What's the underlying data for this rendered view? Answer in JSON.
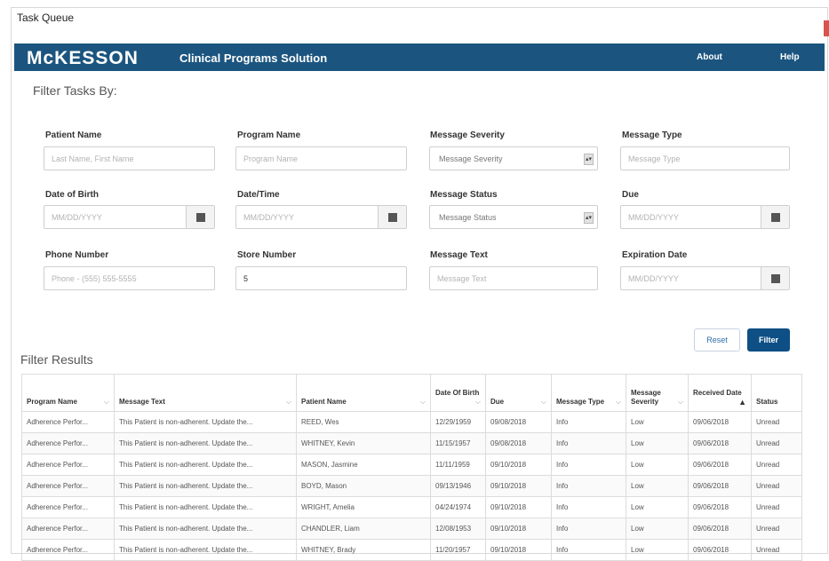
{
  "window": {
    "title": "Task Queue"
  },
  "header": {
    "brand": "McKESSON",
    "subtitle": "Clinical Programs Solution",
    "nav_about": "About",
    "nav_help": "Help",
    "bg_color": "#1b557f"
  },
  "filter": {
    "heading": "Filter Tasks By:",
    "patient_name": {
      "label": "Patient Name",
      "placeholder": "Last Name, First Name"
    },
    "program_name": {
      "label": "Program Name",
      "placeholder": "Program Name"
    },
    "message_severity": {
      "label": "Message Severity",
      "value": "Message Severity"
    },
    "message_type": {
      "label": "Message Type",
      "placeholder": "Message Type"
    },
    "date_of_birth": {
      "label": "Date of Birth",
      "placeholder": "MM/DD/YYYY"
    },
    "date_time": {
      "label": "Date/Time",
      "placeholder": "MM/DD/YYYY"
    },
    "message_status": {
      "label": "Message Status",
      "value": "Message Status"
    },
    "due": {
      "label": "Due",
      "placeholder": "MM/DD/YYYY"
    },
    "phone_number": {
      "label": "Phone Number",
      "placeholder": "Phone - (555) 555-5555"
    },
    "store_number": {
      "label": "Store Number",
      "value": "5"
    },
    "message_text": {
      "label": "Message Text",
      "placeholder": "Message Text"
    },
    "expiration_date": {
      "label": "Expiration Date",
      "placeholder": "MM/DD/YYYY"
    },
    "reset_label": "Reset",
    "filter_label": "Filter"
  },
  "results": {
    "heading": "Filter Results",
    "columns": [
      "Program Name",
      "Message Text",
      "Patient Name",
      "Date Of Birth",
      "Due",
      "Message Type",
      "Message Severity",
      "Received Date",
      "Status"
    ],
    "rows": [
      [
        "Adherence Perfor...",
        "This Patient is non-adherent. Update the...",
        "REED, Wes",
        "12/29/1959",
        "09/08/2018",
        "Info",
        "Low",
        "09/06/2018",
        "Unread"
      ],
      [
        "Adherence Perfor...",
        "This Patient is non-adherent. Update the...",
        "WHITNEY, Kevin",
        "11/15/1957",
        "09/08/2018",
        "Info",
        "Low",
        "09/06/2018",
        "Unread"
      ],
      [
        "Adherence Perfor...",
        "This Patient is non-adherent. Update the...",
        "MASON, Jasmine",
        "11/11/1959",
        "09/10/2018",
        "Info",
        "Low",
        "09/06/2018",
        "Unread"
      ],
      [
        "Adherence Perfor...",
        "This Patient is non-adherent. Update the...",
        "BOYD, Mason",
        "09/13/1946",
        "09/10/2018",
        "Info",
        "Low",
        "09/06/2018",
        "Unread"
      ],
      [
        "Adherence Perfor...",
        "This Patient is non-adherent. Update the...",
        "WRIGHT, Amelia",
        "04/24/1974",
        "09/10/2018",
        "Info",
        "Low",
        "09/06/2018",
        "Unread"
      ],
      [
        "Adherence Perfor...",
        "This Patient is non-adherent. Update the...",
        "CHANDLER, Liam",
        "12/08/1953",
        "09/10/2018",
        "Info",
        "Low",
        "09/06/2018",
        "Unread"
      ],
      [
        "Adherence Perfor...",
        "This Patient is non-adherent. Update the...",
        "WHITNEY, Brady",
        "11/20/1957",
        "09/10/2018",
        "Info",
        "Low",
        "09/06/2018",
        "Unread"
      ]
    ]
  }
}
